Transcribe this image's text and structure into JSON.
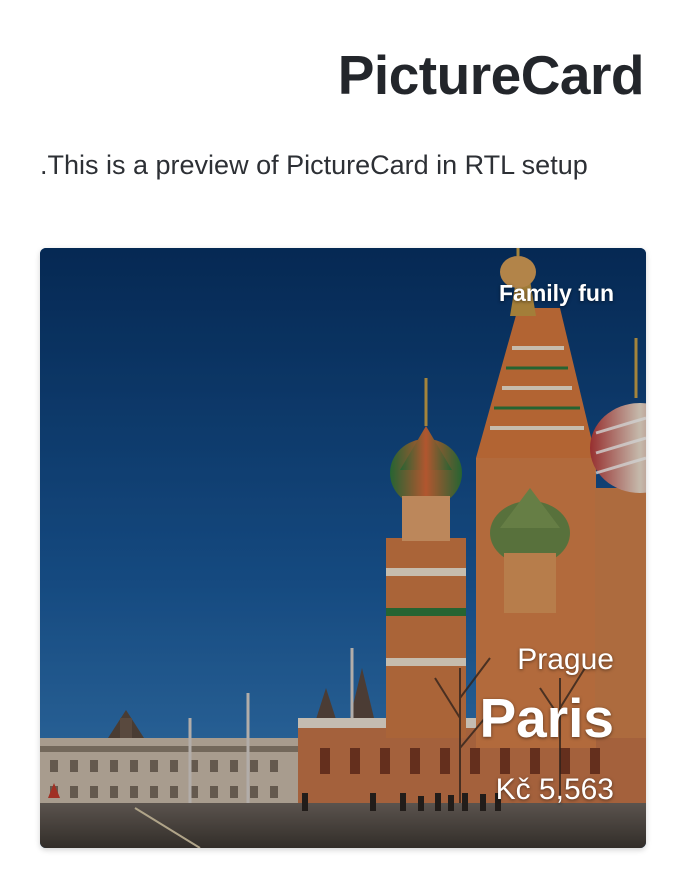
{
  "page": {
    "title": "PictureCard",
    "description": ".This is a preview of PictureCard in RTL setup"
  },
  "card": {
    "tag": "Family fun",
    "subtitle": "Prague",
    "title": "Paris",
    "price": "Kč 5,563",
    "image_description": "cathedral-photo"
  },
  "colors": {
    "text": "#23262b",
    "card_text": "#ffffff",
    "sky_top": "#0a3a73",
    "sky_bottom": "#2b6fb0"
  }
}
